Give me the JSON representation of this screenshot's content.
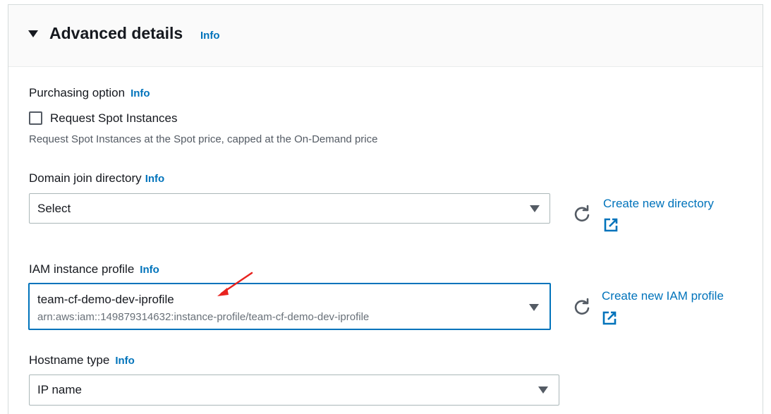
{
  "section": {
    "title": "Advanced details",
    "info": "Info"
  },
  "purchasing": {
    "label": "Purchasing option",
    "info": "Info",
    "checkbox_label": "Request Spot Instances",
    "checked": false,
    "hint": "Request Spot Instances at the Spot price, capped at the On-Demand price"
  },
  "domain_join": {
    "label": "Domain join directory",
    "info": "Info",
    "value": "Select",
    "create_link": "Create new directory"
  },
  "iam_profile": {
    "label": "IAM instance profile",
    "info": "Info",
    "value": "team-cf-demo-dev-iprofile",
    "sub_value": "arn:aws:iam::149879314632:instance-profile/team-cf-demo-dev-iprofile",
    "create_link": "Create new IAM profile"
  },
  "hostname": {
    "label": "Hostname type",
    "info": "Info",
    "value": "IP name"
  },
  "colors": {
    "link": "#0073bb",
    "focus_border": "#0073bb",
    "annotation_arrow": "#e8231f"
  },
  "icons": [
    "caret-down-icon",
    "refresh-icon",
    "external-link-icon",
    "dropdown-arrow-icon",
    "annotation-arrow-icon"
  ]
}
